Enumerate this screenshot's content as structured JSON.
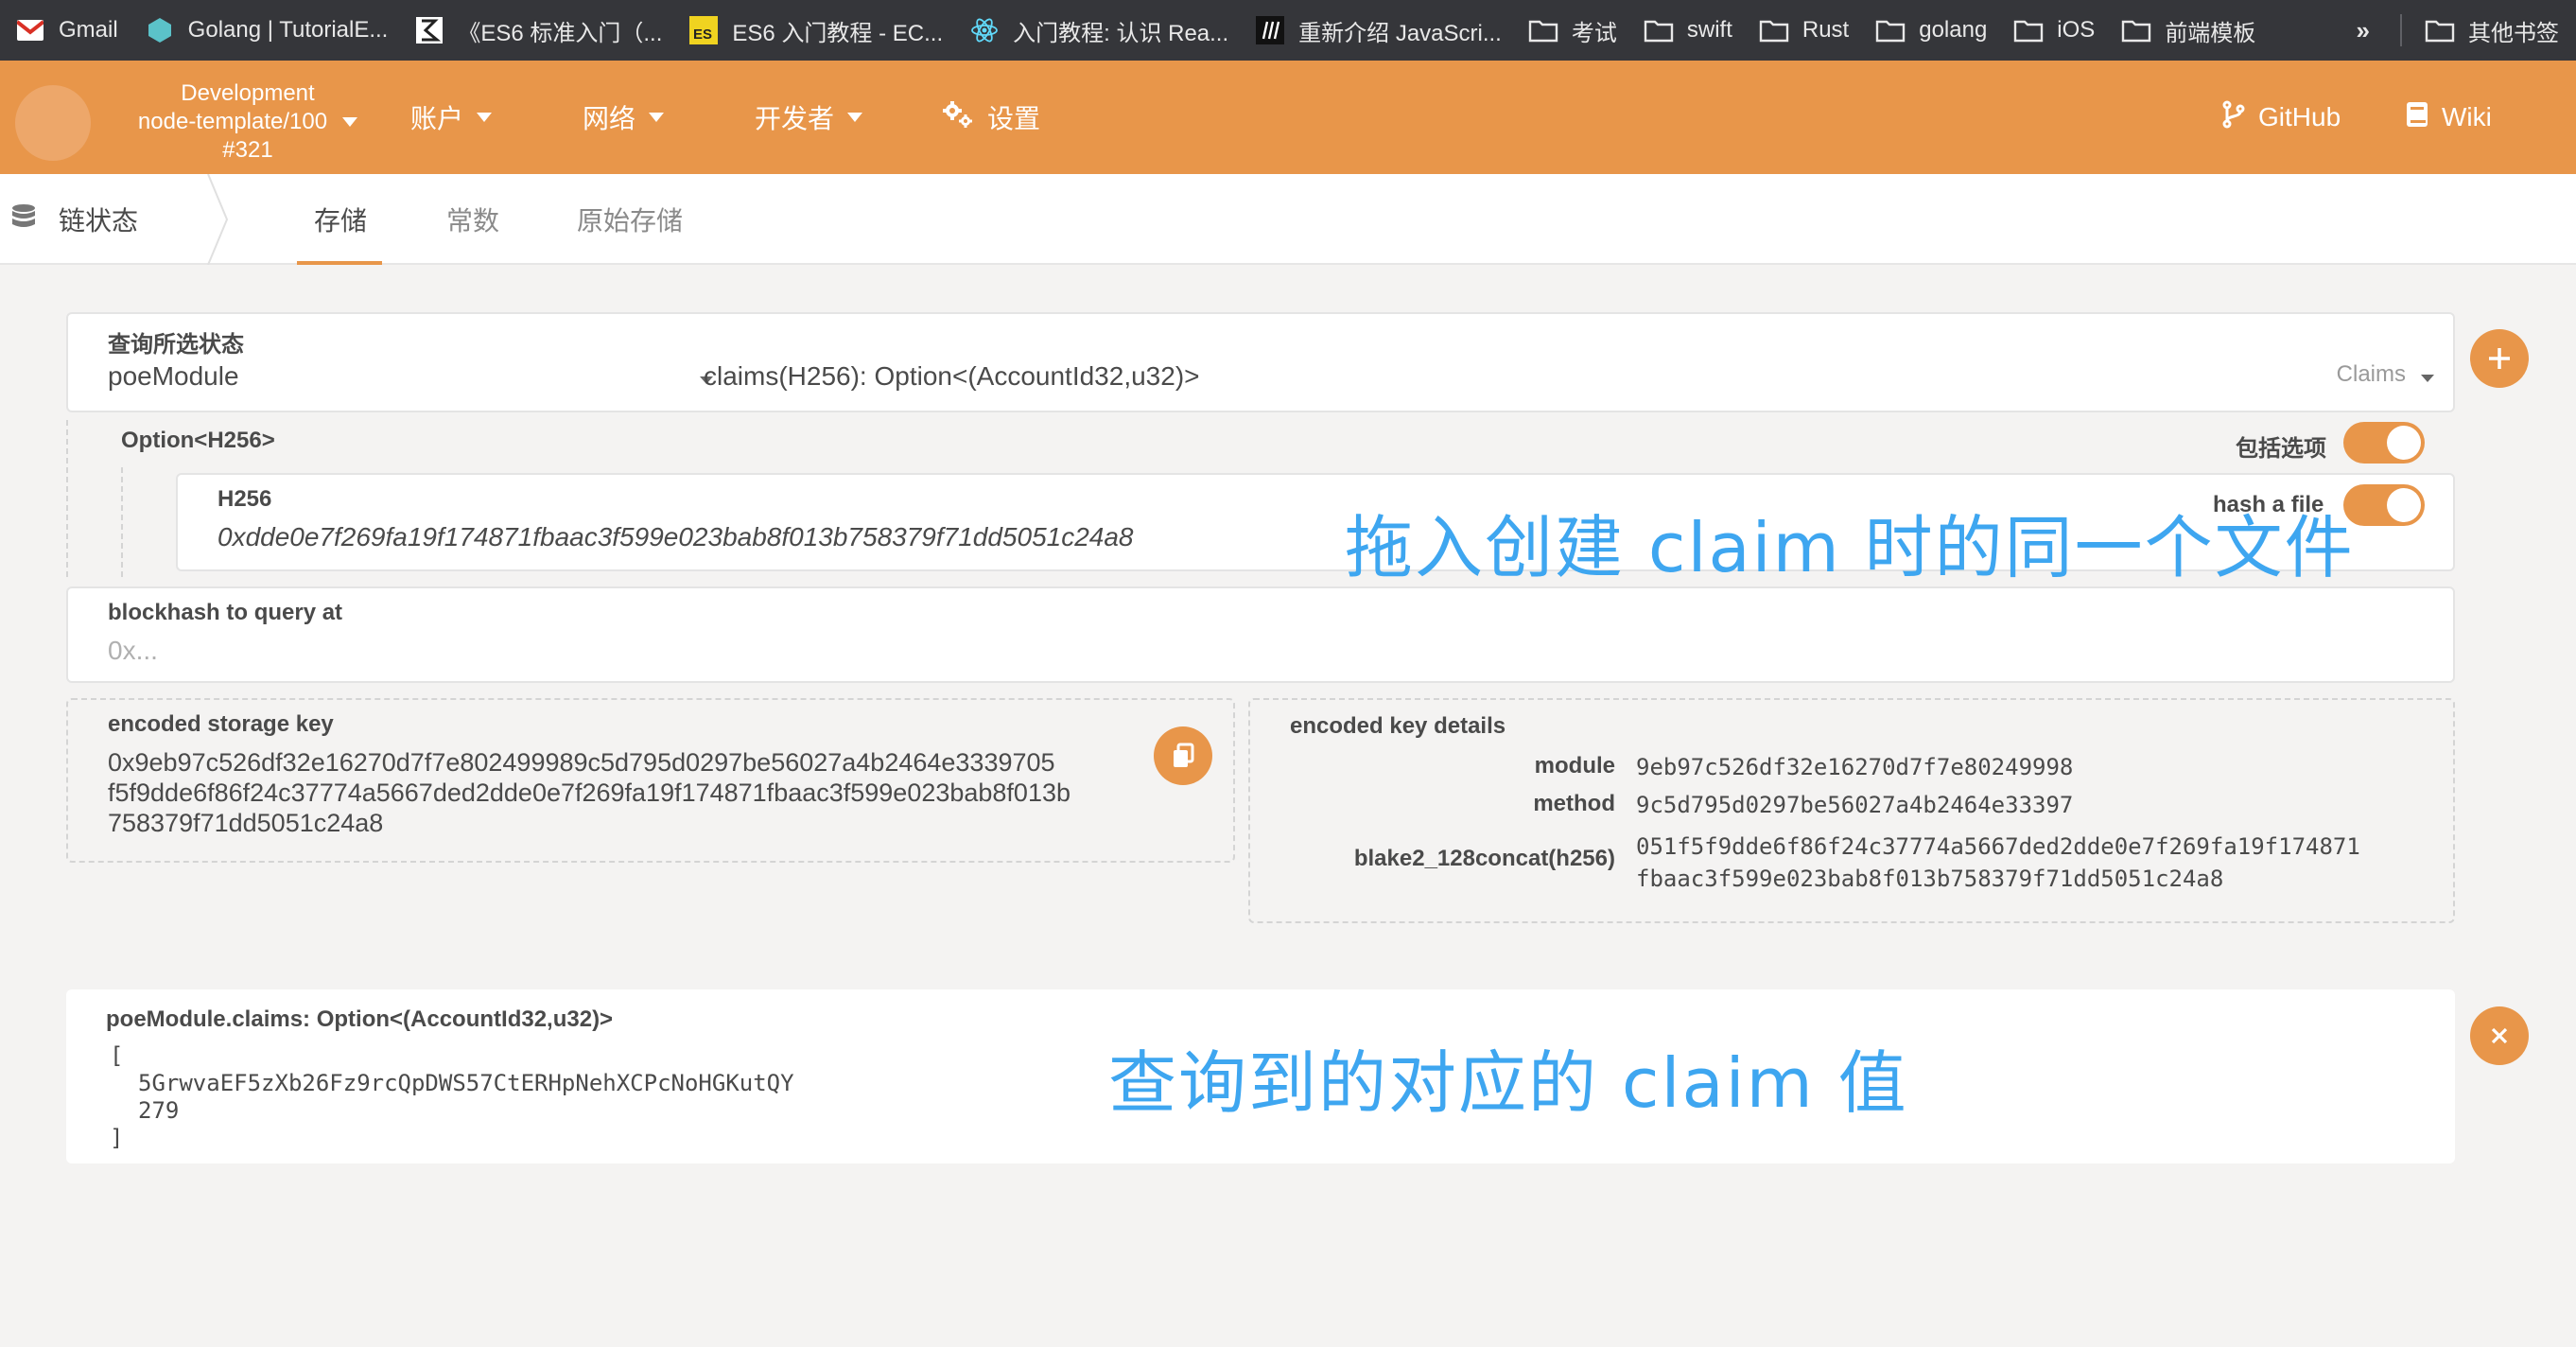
{
  "bookmarks": [
    {
      "icon": "gmail-icon",
      "label": "Gmail"
    },
    {
      "icon": "golang-tutorial-icon",
      "label": "Golang | TutorialE..."
    },
    {
      "icon": "es6-book-icon",
      "label": "《ES6 标准入门（..."
    },
    {
      "icon": "es-icon",
      "label": "ES6 入门教程 - EC..."
    },
    {
      "icon": "react-icon",
      "label": "入门教程: 认识 Rea..."
    },
    {
      "icon": "mdn-icon",
      "label": "重新介绍 JavaScri..."
    },
    {
      "icon": "folder-icon",
      "label": "考试"
    },
    {
      "icon": "folder-icon",
      "label": "swift"
    },
    {
      "icon": "folder-icon",
      "label": "Rust"
    },
    {
      "icon": "folder-icon",
      "label": "golang"
    },
    {
      "icon": "folder-icon",
      "label": "iOS"
    },
    {
      "icon": "folder-icon",
      "label": "前端模板"
    }
  ],
  "bookmarks_more": "»",
  "bookmarks_other": "其他书签",
  "header": {
    "chain_name": "Development",
    "node": "node-template/100",
    "block": "#321",
    "nav": [
      "账户",
      "网络",
      "开发者"
    ],
    "settings": "设置",
    "github": "GitHub",
    "wiki": "Wiki"
  },
  "subnav": {
    "section": "链状态",
    "tabs": [
      "存储",
      "常数",
      "原始存储"
    ]
  },
  "query": {
    "title": "查询所选状态",
    "module": "poeModule",
    "method_signature": "claims(H256): Option<(AccountId32,u32)>",
    "method_short": "Claims"
  },
  "option_param": {
    "label": "Option<H256>",
    "include_option_label": "包括选项",
    "h256_label": "H256",
    "h256_value": "0xdde0e7f269fa19f174871fbaac3f599e023bab8f013b758379f71dd5051c24a8",
    "hash_file_label": "hash a file"
  },
  "blockhash": {
    "label": "blockhash to query at",
    "placeholder": "0x..."
  },
  "encoded_key": {
    "label": "encoded storage key",
    "lines": [
      "0x9eb97c526df32e16270d7f7e802499989c5d795d0297be56027a4b2464e3339705",
      "f5f9dde6f86f24c37774a5667ded2dde0e7f269fa19f174871fbaac3f599e023bab8f013b",
      "758379f71dd5051c24a8"
    ]
  },
  "key_details": {
    "label": "encoded key details",
    "module_key": "module",
    "module_val": "9eb97c526df32e16270d7f7e80249998",
    "method_key": "method",
    "method_val": "9c5d795d0297be56027a4b2464e33397",
    "hasher_key": "blake2_128concat(h256)",
    "hasher_val_1": "051f5f9dde6f86f24c37774a5667ded2dde0e7f269fa19f174871",
    "hasher_val_2": "fbaac3f599e023bab8f013b758379f71dd5051c24a8"
  },
  "result": {
    "label": "poeModule.claims: Option<(AccountId32,u32)>",
    "open": "[",
    "account": "5GrwvaEF5zXb26Fz9rcQpDWS57CtERHpNehXCPcNoHGKutQY",
    "block": "279",
    "close": "]"
  },
  "annotations": {
    "drag_file": "拖入创建 claim 时的同一个文件",
    "claim_value": "查询到的对应的 claim 值"
  },
  "colors": {
    "accent": "#e8964a",
    "annotation": "#3ea6f0"
  }
}
